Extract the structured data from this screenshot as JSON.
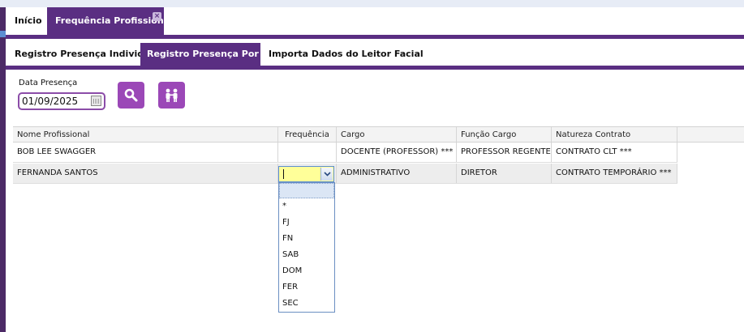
{
  "app": {
    "main_tabs": [
      {
        "label": "Início"
      },
      {
        "label": "Frequência Profissional",
        "close_icon": "×"
      }
    ],
    "sub_tabs": [
      {
        "label": "Registro Presença Individual"
      },
      {
        "label": "Registro Presença Por Dia"
      },
      {
        "label": "Importa Dados do Leitor Facial"
      }
    ]
  },
  "form": {
    "date_label": "Data Presença",
    "date_value": "01/09/2025",
    "calendar_icon": "calendar-icon",
    "search_button_icon": "search-icon",
    "people_button_icon": "people-icon"
  },
  "grid": {
    "columns": [
      "Nome Profissional",
      "Frequência",
      "Cargo",
      "Função Cargo",
      "Natureza Contrato"
    ],
    "rows": [
      {
        "nome": "BOB LEE SWAGGER",
        "frequencia": "",
        "cargo": "DOCENTE (PROFESSOR) ***",
        "funcao": "PROFESSOR REGENTE",
        "natureza": "CONTRATO CLT ***"
      },
      {
        "nome": "FERNANDA SANTOS",
        "frequencia": "",
        "cargo": "ADMINISTRATIVO",
        "funcao": "DIRETOR",
        "natureza": "CONTRATO TEMPORÁRIO ***"
      }
    ]
  },
  "frequency_dropdown": {
    "options": [
      "",
      "*",
      "FJ",
      "FN",
      "SAB",
      "DOM",
      "FER",
      "SEC"
    ]
  },
  "colors": {
    "brand_purple": "#5a2e82",
    "button_purple": "#9b48b7",
    "highlight_yellow": "#ffff99"
  }
}
